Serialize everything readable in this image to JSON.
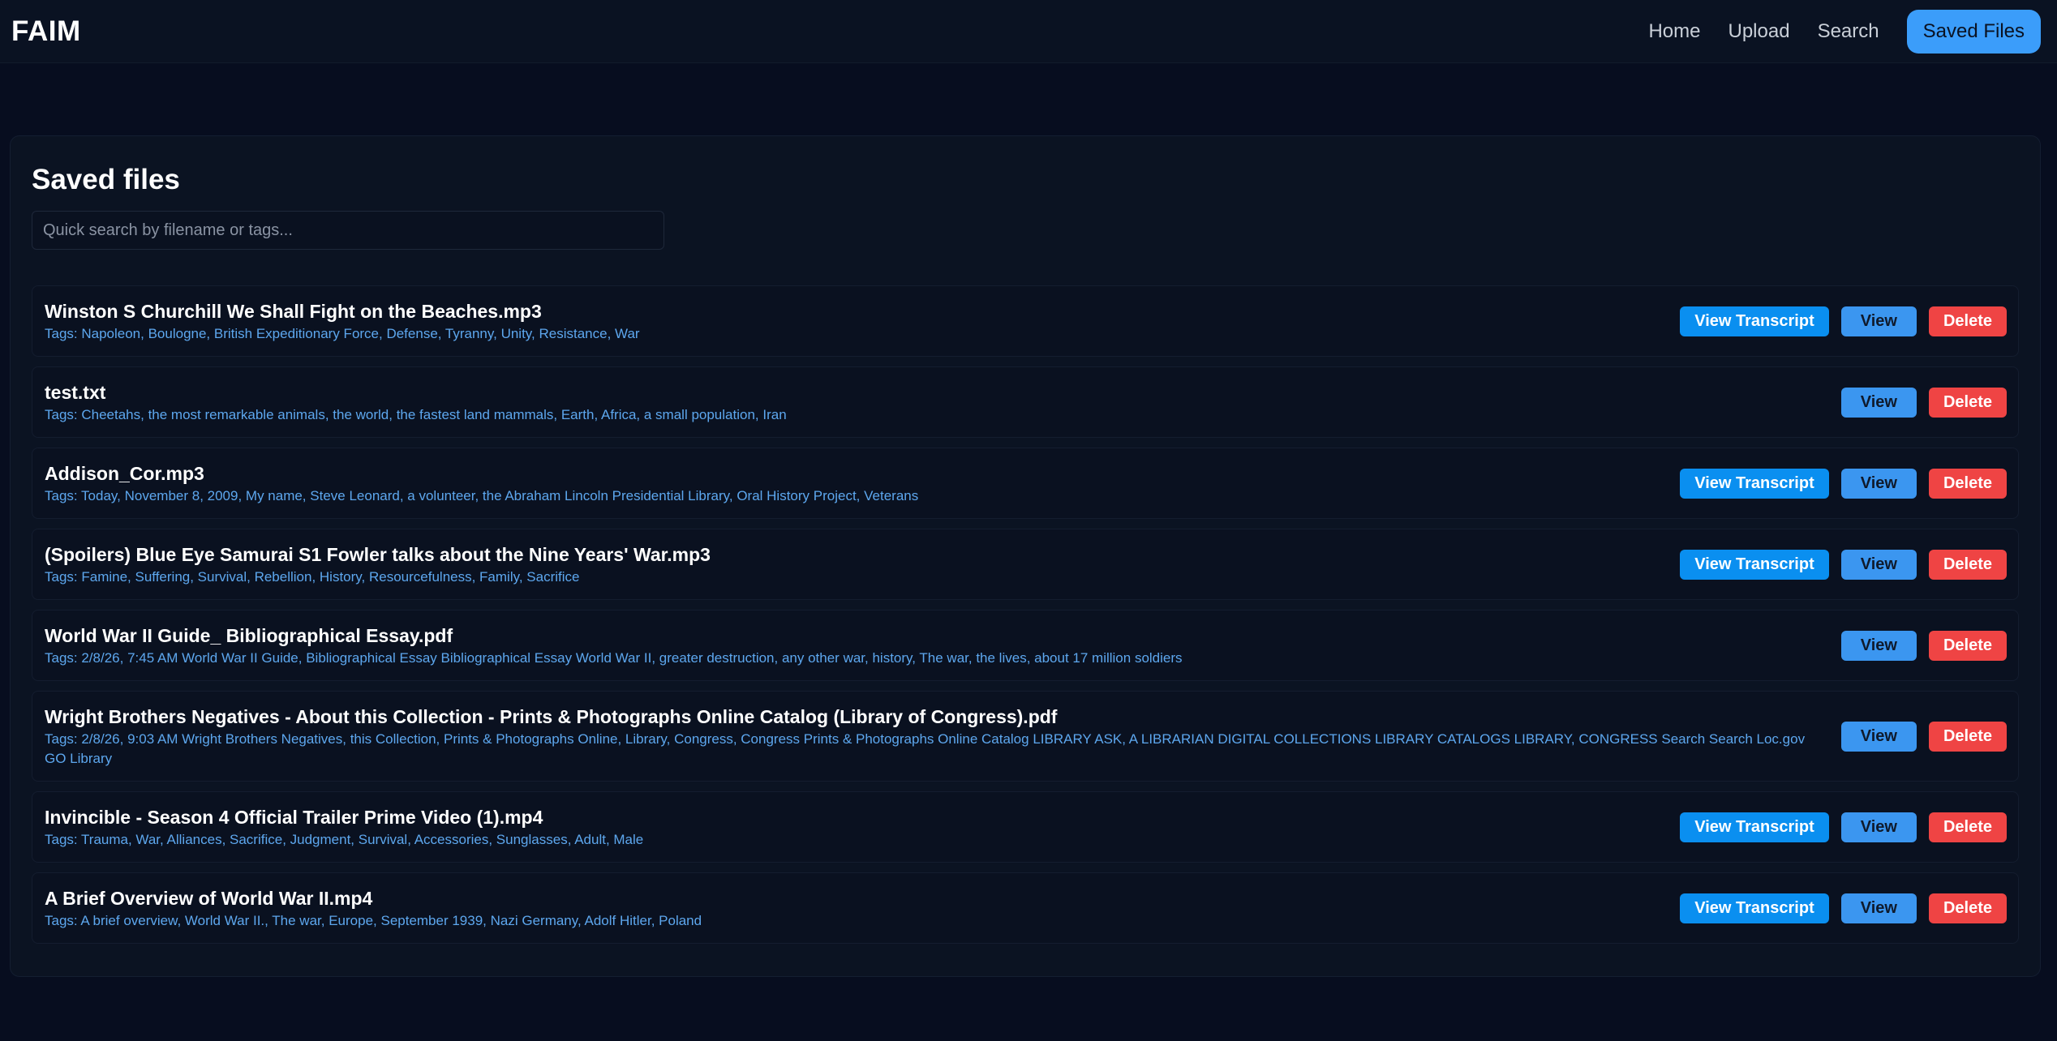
{
  "nav": {
    "brand": "FAIM",
    "links": [
      {
        "label": "Home"
      },
      {
        "label": "Upload"
      },
      {
        "label": "Search"
      },
      {
        "label": "Saved Files",
        "active": true
      }
    ]
  },
  "main": {
    "title": "Saved files",
    "search_placeholder": "Quick search by filename or tags...",
    "search_value": "",
    "buttons": {
      "transcript": "View Transcript",
      "view": "View",
      "delete": "Delete"
    },
    "files": [
      {
        "name": "Winston S Churchill We Shall Fight on the Beaches.mp3",
        "tags": "Tags: Napoleon, Boulogne, British Expeditionary Force, Defense, Tyranny, Unity, Resistance, War",
        "has_transcript": true
      },
      {
        "name": "test.txt",
        "tags": "Tags: Cheetahs, the most remarkable animals, the world, the fastest land mammals, Earth, Africa, a small population, Iran",
        "has_transcript": false
      },
      {
        "name": "Addison_Cor.mp3",
        "tags": "Tags: Today, November 8, 2009, My name, Steve Leonard, a volunteer, the Abraham Lincoln Presidential Library, Oral History Project, Veterans",
        "has_transcript": true
      },
      {
        "name": "(Spoilers) Blue Eye Samurai S1 Fowler talks about the Nine Years' War.mp3",
        "tags": "Tags: Famine, Suffering, Survival, Rebellion, History, Resourcefulness, Family, Sacrifice",
        "has_transcript": true
      },
      {
        "name": "World War II Guide_ Bibliographical Essay.pdf",
        "tags": "Tags: 2/8/26, 7:45 AM World War II Guide, Bibliographical Essay Bibliographical Essay World War II, greater destruction, any other war, history, The war, the lives, about 17 million soldiers",
        "has_transcript": false
      },
      {
        "name": "Wright Brothers Negatives - About this Collection - Prints & Photographs Online Catalog (Library of Congress).pdf",
        "tags": "Tags: 2/8/26, 9:03 AM Wright Brothers Negatives, this Collection, Prints & Photographs Online, Library, Congress, Congress Prints & Photographs Online Catalog LIBRARY ASK, A LIBRARIAN DIGITAL COLLECTIONS LIBRARY CATALOGS LIBRARY, CONGRESS Search Search Loc.gov GO Library",
        "has_transcript": false
      },
      {
        "name": "Invincible - Season 4 Official Trailer Prime Video (1).mp4",
        "tags": "Tags: Trauma, War, Alliances, Sacrifice, Judgment, Survival, Accessories, Sunglasses, Adult, Male",
        "has_transcript": true
      },
      {
        "name": "A Brief Overview of World War II.mp4",
        "tags": "Tags: A brief overview, World War II., The war, Europe, September 1939, Nazi Germany, Adolf Hitler, Poland",
        "has_transcript": true
      }
    ]
  },
  "colors": {
    "background": "#070d1f",
    "accent": "#3b9dfa",
    "tags": "#5da7ee",
    "delete": "#ef4444",
    "transcript": "#0a8ff0"
  }
}
